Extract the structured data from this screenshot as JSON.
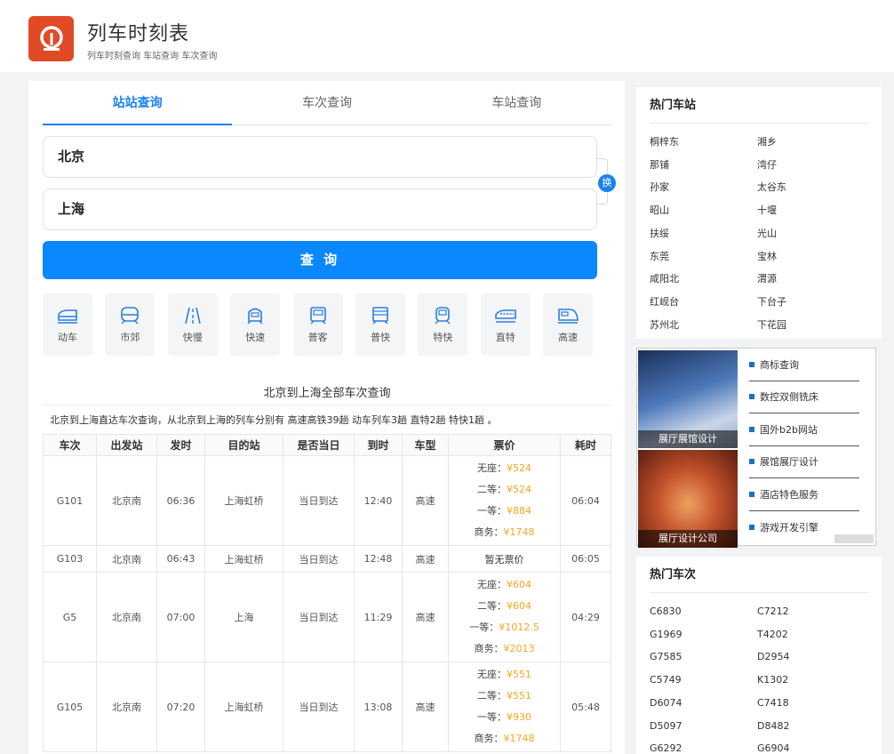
{
  "header": {
    "title": "列车时刻表",
    "subtitle": "列车时刻查询 车站查询 车次查询"
  },
  "tabs": [
    {
      "label": "站站查询",
      "active": true
    },
    {
      "label": "车次查询",
      "active": false
    },
    {
      "label": "车站查询",
      "active": false
    }
  ],
  "search": {
    "from": "北京",
    "to": "上海",
    "swap_label": "换",
    "button_label": "查 询"
  },
  "train_types": [
    {
      "label": "动车",
      "icon": "bullet-train-icon"
    },
    {
      "label": "市郊",
      "icon": "suburban-train-icon"
    },
    {
      "label": "快慢",
      "icon": "track-icon"
    },
    {
      "label": "快速",
      "icon": "fast-train-icon"
    },
    {
      "label": "普客",
      "icon": "passenger-train-icon"
    },
    {
      "label": "普快",
      "icon": "express-train-icon"
    },
    {
      "label": "特快",
      "icon": "special-express-icon"
    },
    {
      "label": "直特",
      "icon": "direct-express-icon"
    },
    {
      "label": "高速",
      "icon": "high-speed-train-icon"
    }
  ],
  "results": {
    "title": "北京到上海全部车次查询",
    "description": "北京到上海直达车次查询，从北京到上海的列车分别有 高速高铁39趟 动车列车3趟 直特2趟 特快1趟 。",
    "columns": [
      "车次",
      "出发站",
      "发时",
      "目的站",
      "是否当日",
      "到时",
      "车型",
      "票价",
      "耗时"
    ],
    "rows": [
      {
        "train": "G101",
        "from": "北京南",
        "dep": "06:36",
        "to": "上海虹桥",
        "same_day": "当日到达",
        "arr": "12:40",
        "type": "高速",
        "prices": [
          {
            "k": "无座：",
            "v": "¥524"
          },
          {
            "k": "二等：",
            "v": "¥524"
          },
          {
            "k": "一等：",
            "v": "¥884"
          },
          {
            "k": "商务：",
            "v": "¥1748"
          }
        ],
        "duration": "06:04"
      },
      {
        "train": "G103",
        "from": "北京南",
        "dep": "06:43",
        "to": "上海虹桥",
        "same_day": "当日到达",
        "arr": "12:48",
        "type": "高速",
        "no_price": "暂无票价",
        "duration": "06:05"
      },
      {
        "train": "G5",
        "from": "北京南",
        "dep": "07:00",
        "to": "上海",
        "same_day": "当日到达",
        "arr": "11:29",
        "type": "高速",
        "prices": [
          {
            "k": "无座：",
            "v": "¥604"
          },
          {
            "k": "二等：",
            "v": "¥604"
          },
          {
            "k": "一等：",
            "v": "¥1012.5"
          },
          {
            "k": "商务：",
            "v": "¥2013"
          }
        ],
        "duration": "04:29"
      },
      {
        "train": "G105",
        "from": "北京南",
        "dep": "07:20",
        "to": "上海虹桥",
        "same_day": "当日到达",
        "arr": "13:08",
        "type": "高速",
        "prices": [
          {
            "k": "无座：",
            "v": "¥551"
          },
          {
            "k": "二等：",
            "v": "¥551"
          },
          {
            "k": "一等：",
            "v": "¥930"
          },
          {
            "k": "商务：",
            "v": "¥1748"
          }
        ],
        "duration": "05:48"
      }
    ]
  },
  "hot_stations": {
    "title": "热门车站",
    "items": [
      "桐梓东",
      "湘乡",
      "那铺",
      "湾仔",
      "孙家",
      "太谷东",
      "昭山",
      "十堰",
      "扶绥",
      "光山",
      "东莞",
      "宝林",
      "咸阳北",
      "渭源",
      "红岘台",
      "下台子",
      "苏州北",
      "下花园"
    ]
  },
  "ad": {
    "captions": [
      "展厅展馆设计",
      "展厅设计公司"
    ],
    "links": [
      "商标查询",
      "数控双侧铣床",
      "国外b2b网站",
      "展馆展厅设计",
      "酒店特色服务",
      "游戏开发引擎"
    ]
  },
  "hot_trains": {
    "title": "热门车次",
    "items": [
      "C6830",
      "C7212",
      "G1969",
      "T4202",
      "G7585",
      "D2954",
      "C5749",
      "K1302",
      "D6074",
      "C7418",
      "D5097",
      "D8482",
      "G6292",
      "G6904"
    ]
  },
  "colors": {
    "accent": "#1a82f0",
    "button": "#0a88ff",
    "price": "#f5a623",
    "logo": "#e04a26"
  }
}
